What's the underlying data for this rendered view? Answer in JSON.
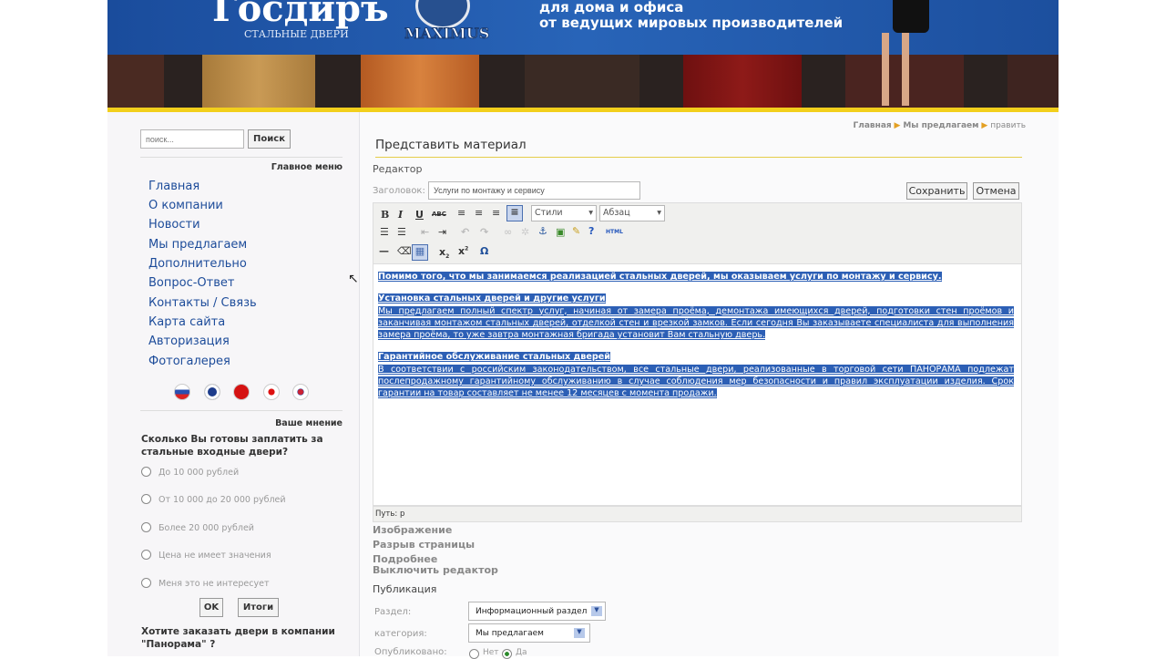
{
  "header": {
    "logo_text": "Госдиръ",
    "logo_sub": "СТАЛЬНЫЕ ДВЕРИ",
    "emblem": "MAXIMUS",
    "slogan": [
      "для дома и офиса",
      "от ведущих мировых производителей"
    ]
  },
  "breadcrumb": [
    "Главная",
    "Мы предлагаем",
    "править"
  ],
  "search": {
    "placeholder": "поиск...",
    "button": "Поиск"
  },
  "menu": {
    "title": "Главное меню",
    "items": [
      "Главная",
      "О компании",
      "Новости",
      "Мы предлагаем",
      "Дополнительно",
      "Вопрос-Ответ",
      "Контакты / Связь",
      "Карта сайта",
      "Авторизация",
      "Фотогалерея"
    ]
  },
  "poll": {
    "title": "Ваше мнение",
    "question": "Сколько Вы готовы заплатить за стальные входные двери?",
    "options": [
      "До 10 000 рублей",
      "От 10 000 до 20 000 рублей",
      "Более 20 000 рублей",
      "Цена не имеет значения",
      "Меня это не интересует"
    ],
    "ok": "OK",
    "results": "Итоги"
  },
  "order_q": "Хотите заказать двери в компании \"Панорама\" ?",
  "form": {
    "page_title": "Представить материал",
    "section": "Редактор",
    "title_label": "Заголовок:",
    "title_value": "Услуги по монтажу и сервису",
    "save": "Сохранить",
    "cancel": "Отмена",
    "styles": "Стили",
    "format": "Абзац",
    "html": "HTML",
    "path": "Путь: p"
  },
  "content": {
    "p1": "Помимо того, что мы занимаемся реализацией стальных дверей, мы оказываем услуги по монтажу и сервису.",
    "h2": "Установка стальных дверей и другие услуги",
    "p2": "Мы предлагаем полный спектр услуг, начиная от замера проёма, демонтажа имеющихся дверей, подготовки стен проёмов и заканчивая монтажом стальных дверей, отделкой стен и врезкой замков. Если сегодня Вы заказываете специалиста для выполнения замера проёма, то уже завтра монтажная бригада установит Вам стальную дверь.",
    "h3": "Гарантийное обслуживание стальных дверей",
    "p3": "В соответствии с российским законодательством, все стальные двери, реализованные в торговой сети ПАНОРАМА подлежат послепродажному гарантийному обслуживанию в случае соблюдения мер безопасности и правил эксплуатации изделия. Срок гарантии на товар составляет не менее 12 месяцев с момента продажи."
  },
  "links": [
    "Изображение",
    "Разрыв страницы",
    "Подробнее",
    "Выключить редактор"
  ],
  "publish": {
    "title": "Публикация",
    "section_label": "Раздел:",
    "section_value": "Информационный раздел",
    "category_label": "категория:",
    "category_value": "Мы предлагаем",
    "published_label": "Опубликовано:",
    "no": "Нет",
    "yes": "Да"
  }
}
